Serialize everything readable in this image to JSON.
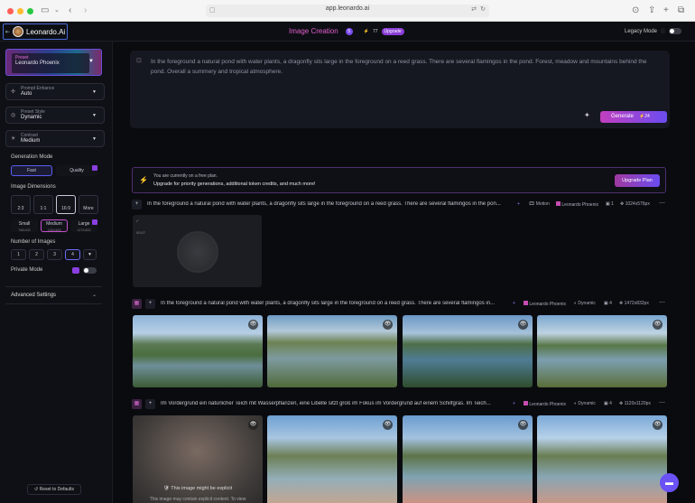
{
  "browser": {
    "url": "app.leonardo.ai"
  },
  "header": {
    "brand": "Leonardo.Ai",
    "title": "Image Creation",
    "title_badge": "5",
    "tokens": "77",
    "upgrade": "Upgrade",
    "legacy_mode": "Legacy Mode"
  },
  "sidebar": {
    "preset": {
      "label": "Preset",
      "value": "Leonardo Phoenix"
    },
    "prompt_enhance": {
      "label": "Prompt Enhance",
      "value": "Auto"
    },
    "preset_style": {
      "label": "Preset Style",
      "value": "Dynamic"
    },
    "contrast": {
      "label": "Contrast",
      "value": "Medium"
    },
    "generation_mode": {
      "label": "Generation Mode",
      "fast": "Fast",
      "quality": "Quality"
    },
    "image_dimensions": {
      "label": "Image Dimensions",
      "ratios": [
        "2:3",
        "1:1",
        "16:9",
        "More"
      ],
      "sizes": [
        {
          "name": "Small",
          "res": "768x432"
        },
        {
          "name": "Medium",
          "res": "1184x666"
        },
        {
          "name": "Large",
          "res": "1472x832"
        }
      ]
    },
    "number_of_images": {
      "label": "Number of Images",
      "options": [
        "1",
        "2",
        "3",
        "4"
      ]
    },
    "private_mode": "Private Mode",
    "advanced_settings": "Advanced Settings",
    "reset": "Reset to Defaults"
  },
  "prompt": {
    "text": "In the foreground a natural pond with water plants, a dragonfly sits large in the foreground on a reed grass. There are several flamingos in the pond. Forest, meadow and mountains behind the pond. Overall a summery and tropical atmosphere.",
    "generate": "Generate",
    "cost": "24"
  },
  "banner": {
    "line1": "You are currently on a free plan.",
    "line2": "Upgrade for priority generations, additional token credits, and much more!",
    "button": "Upgrade Plan"
  },
  "generations": [
    {
      "prompt": "In the foreground a natural pond with water plants, a dragonfly sits large in the foreground on a reed grass. There are several flamingos in the pon...",
      "tags": [
        "Motion",
        "Leonardo Phoenix",
        "1",
        "1024x576px"
      ],
      "timer": "00:07"
    },
    {
      "prompt": "In the foreground a natural pond with water plants, a dragonfly sits large in the foreground on a reed grass. There are several flamingos in...",
      "tags": [
        "Leonardo Phoenix",
        "Dynamic",
        "4",
        "1472x832px"
      ]
    },
    {
      "prompt": "Im Vordergrund ein natürlicher Teich mit Wasserpflanzen, eine Libelle sitzt groß im Fokus im Vordergrund auf einem Schilfgras. Im Teich...",
      "tags": [
        "Leonardo Phoenix",
        "Dynamic",
        "4",
        "1120x1120px"
      ],
      "explicit_title": "This image might be explicit",
      "explicit_text": "This image may contain explicit content. To view"
    }
  ]
}
